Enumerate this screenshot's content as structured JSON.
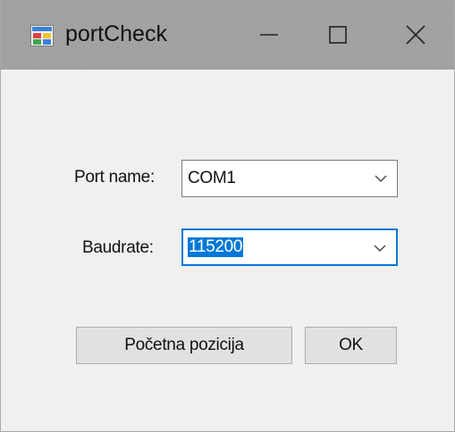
{
  "window": {
    "title": "portCheck"
  },
  "form": {
    "port_label": "Port name:",
    "port_value": "COM1",
    "baud_label": "Baudrate:",
    "baud_value": "115200"
  },
  "buttons": {
    "start_label": "Početna pozicija",
    "ok_label": "OK"
  },
  "colors": {
    "titlebar": "#a2a2a2",
    "window_bg": "#f0f0f0",
    "selection": "#0078d7"
  },
  "icons": {
    "app": "app-window-icon",
    "minimize": "minimize-icon",
    "maximize": "maximize-icon",
    "close": "close-icon",
    "dropdown": "chevron-down-icon"
  }
}
